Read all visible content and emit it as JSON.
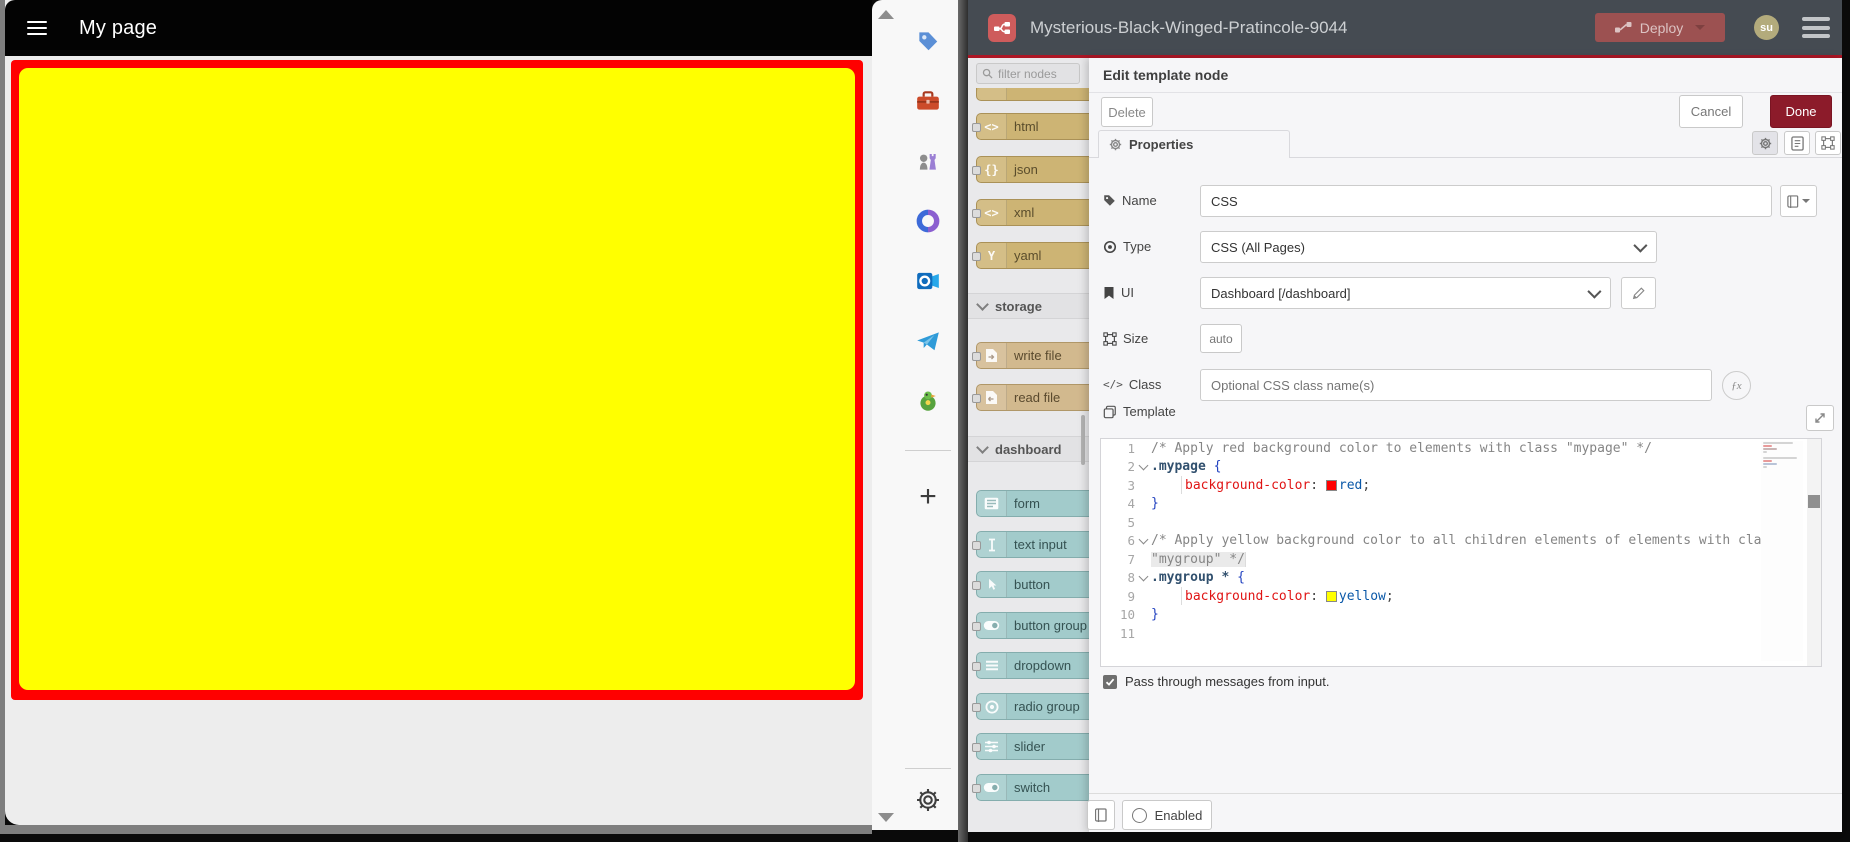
{
  "dashboard_window": {
    "appbar_title": "My page",
    "mypage_color": "#ff0000",
    "mygroup_color": "#ffff00"
  },
  "app_sidebar": {
    "icons": [
      "tag",
      "toolbox",
      "chess-pieces",
      "office-loop",
      "outlook",
      "telegram",
      "bird",
      "add",
      "settings"
    ]
  },
  "node_red": {
    "header": {
      "title": "Mysterious-Black-Winged-Pratincole-9044",
      "deploy_label": "Deploy",
      "avatar_initials": "su"
    },
    "palette": {
      "filter_placeholder": "filter nodes",
      "items": [
        {
          "kind": "node",
          "label": "",
          "color": "parser",
          "icon": "none",
          "sliver": true
        },
        {
          "kind": "node",
          "label": "html",
          "color": "parser",
          "icon": "angle"
        },
        {
          "kind": "node",
          "label": "json",
          "color": "parser",
          "icon": "braces"
        },
        {
          "kind": "node",
          "label": "xml",
          "color": "parser",
          "icon": "angle"
        },
        {
          "kind": "node",
          "label": "yaml",
          "color": "parser",
          "icon": "yletter"
        },
        {
          "kind": "header",
          "label": "storage"
        },
        {
          "kind": "node",
          "label": "write file",
          "color": "storage",
          "icon": "filewrite"
        },
        {
          "kind": "node",
          "label": "read file",
          "color": "storage",
          "icon": "fileread"
        },
        {
          "kind": "header",
          "label": "dashboard"
        },
        {
          "kind": "node",
          "label": "form",
          "color": "ui",
          "icon": "form",
          "noport": true
        },
        {
          "kind": "node",
          "label": "text input",
          "color": "ui",
          "icon": "ibeam"
        },
        {
          "kind": "node",
          "label": "button",
          "color": "ui",
          "icon": "pointer"
        },
        {
          "kind": "node",
          "label": "button group",
          "color": "ui",
          "icon": "toggle"
        },
        {
          "kind": "node",
          "label": "dropdown",
          "color": "ui",
          "icon": "lines"
        },
        {
          "kind": "node",
          "label": "radio group",
          "color": "ui",
          "icon": "radio"
        },
        {
          "kind": "node",
          "label": "slider",
          "color": "ui",
          "icon": "slider"
        },
        {
          "kind": "node",
          "label": "switch",
          "color": "ui",
          "icon": "toggle"
        }
      ]
    },
    "dialog": {
      "title": "Edit template node",
      "delete_label": "Delete",
      "cancel_label": "Cancel",
      "done_label": "Done",
      "tab_label": "Properties",
      "fields": {
        "name": {
          "label": "Name",
          "value": "CSS"
        },
        "type": {
          "label": "Type",
          "value": "CSS (All Pages)"
        },
        "ui": {
          "label": "UI",
          "value": "Dashboard [/dashboard]"
        },
        "size": {
          "label": "Size",
          "value": "auto"
        },
        "class": {
          "label": "Class",
          "placeholder": "Optional CSS class name(s)"
        },
        "template": {
          "label": "Template"
        }
      },
      "code": {
        "language": "css",
        "lines": [
          {
            "n": 1,
            "segs": [
              {
                "t": "/* Apply red background color to elements with class \"mypage\" */",
                "c": "cmt"
              }
            ]
          },
          {
            "n": 2,
            "fold": true,
            "segs": [
              {
                "t": ".mypage",
                "c": "sel"
              },
              {
                "t": " ",
                "c": "pln"
              },
              {
                "t": "{",
                "c": "brc"
              }
            ]
          },
          {
            "n": 3,
            "guide": true,
            "segs": [
              {
                "t": "background-color",
                "c": "prop"
              },
              {
                "t": ": ",
                "c": "pln"
              },
              {
                "t": "",
                "c": "sw sw-red"
              },
              {
                "t": "red",
                "c": "val"
              },
              {
                "t": ";",
                "c": "pln"
              }
            ]
          },
          {
            "n": 4,
            "segs": [
              {
                "t": "}",
                "c": "brc"
              }
            ]
          },
          {
            "n": 5,
            "segs": []
          },
          {
            "n": 6,
            "fold": true,
            "segs": [
              {
                "t": "/* Apply yellow background color to all children elements of elements with class",
                "c": "cmt"
              }
            ]
          },
          {
            "n": 7,
            "segs": [
              {
                "t": "\"mygroup\" */",
                "c": "cmt hl"
              }
            ]
          },
          {
            "n": 8,
            "fold": true,
            "segs": [
              {
                "t": ".mygroup",
                "c": "sel"
              },
              {
                "t": " ",
                "c": "pln"
              },
              {
                "t": "*",
                "c": "sel"
              },
              {
                "t": " ",
                "c": "pln"
              },
              {
                "t": "{",
                "c": "brc"
              }
            ]
          },
          {
            "n": 9,
            "guide": true,
            "segs": [
              {
                "t": "background-color",
                "c": "prop"
              },
              {
                "t": ": ",
                "c": "pln"
              },
              {
                "t": "",
                "c": "sw sw-yellow"
              },
              {
                "t": "yellow",
                "c": "val"
              },
              {
                "t": ";",
                "c": "pln"
              }
            ]
          },
          {
            "n": 10,
            "segs": [
              {
                "t": "}",
                "c": "brc"
              }
            ]
          },
          {
            "n": 11,
            "segs": []
          }
        ]
      },
      "passthrough": {
        "label": "Pass through messages from input.",
        "checked": true
      },
      "enabled_label": "Enabled"
    }
  },
  "colors": {
    "accent_red": "#ad1625",
    "done_red": "#8c1b2a",
    "header_gray": "#454b52",
    "swatch_red": "#ff0000",
    "swatch_yellow": "#ffff00",
    "parser_node": "#cdb474",
    "storage_node": "#d2b98e",
    "ui_node": "#a2cbcb"
  }
}
